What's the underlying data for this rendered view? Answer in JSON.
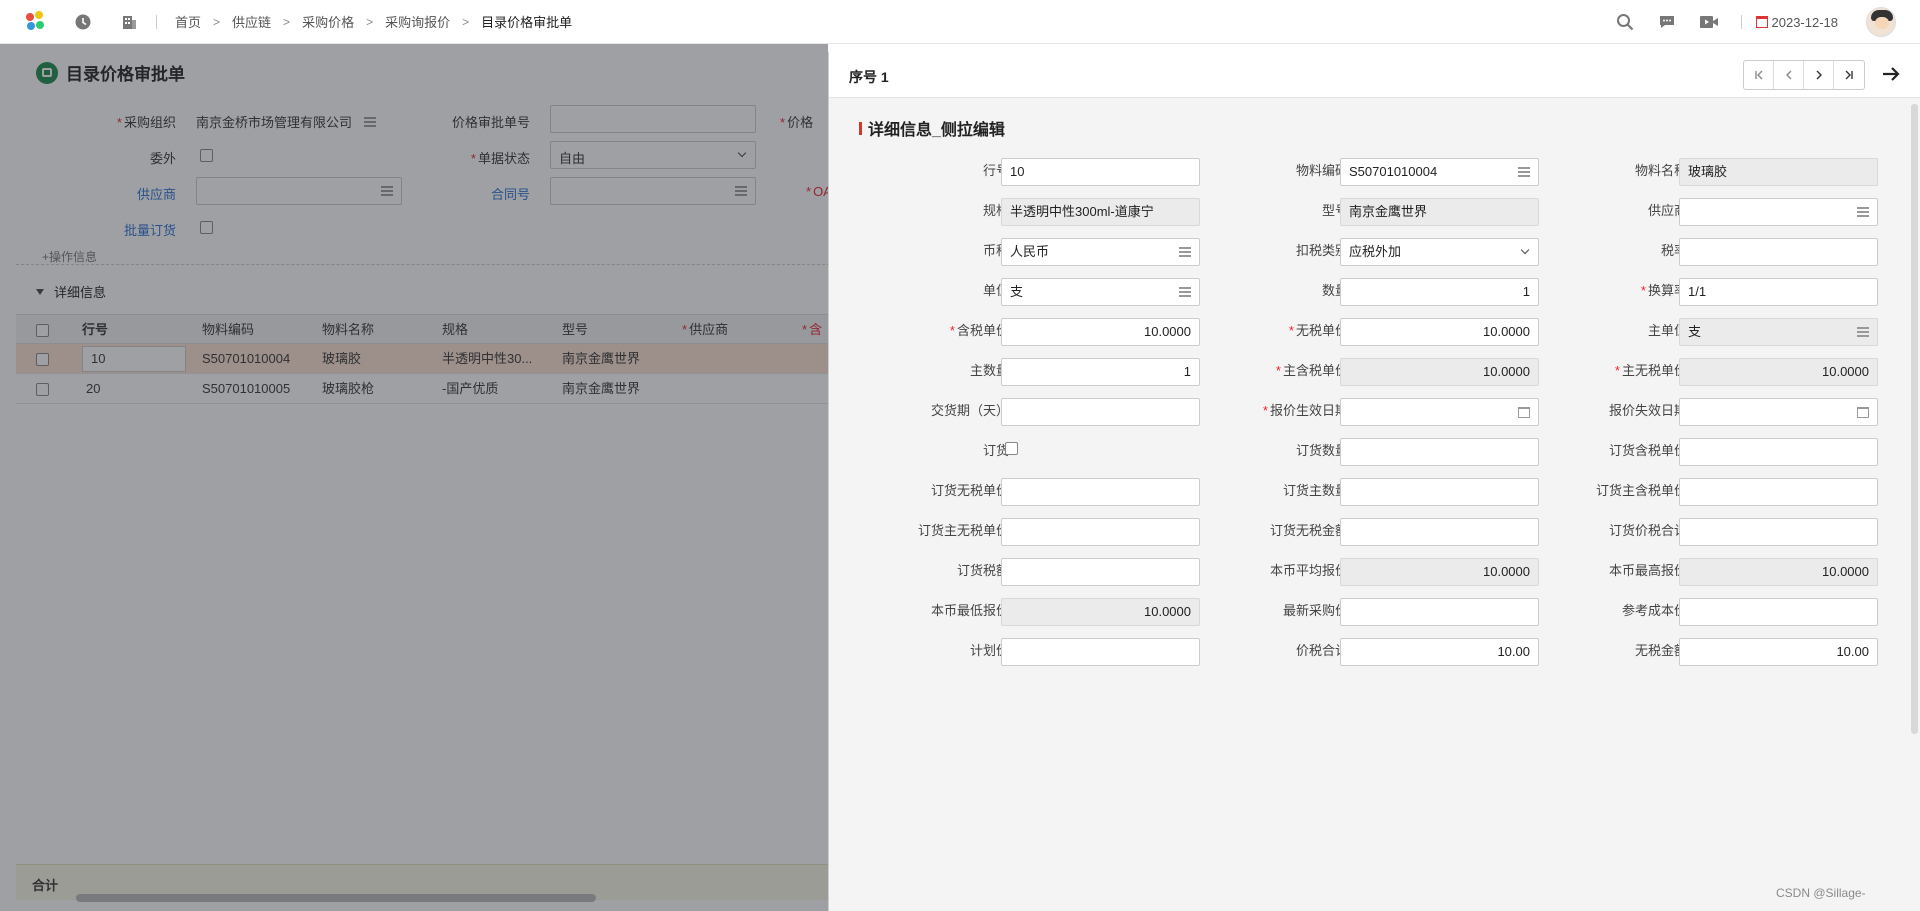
{
  "topbar": {
    "breadcrumb": [
      "首页",
      "供应链",
      "采购价格",
      "采购询报价",
      "目录价格审批单"
    ],
    "date": "2023-12-18"
  },
  "page": {
    "title": "目录价格审批单",
    "form": {
      "purchase_org_label": "采购组织",
      "purchase_org_value": "南京金桥市场管理有限公司",
      "approval_no_label": "价格审批单号",
      "price_label": "价格",
      "outsource_label": "委外",
      "doc_status_label": "单据状态",
      "doc_status_value": "自由",
      "supplier_label": "供应商",
      "contract_label": "合同号",
      "oa_label": "OA",
      "batch_order_label": "批量订货",
      "ops_info": "+操作信息"
    },
    "detail_section": "详细信息",
    "grid": {
      "headers": [
        "行号",
        "物料编码",
        "物料名称",
        "规格",
        "型号",
        "供应商",
        "含"
      ],
      "rows": [
        {
          "line": "10",
          "code": "S50701010004",
          "name": "玻璃胶",
          "spec": "半透明中性30...",
          "model": "南京金鹰世界"
        },
        {
          "line": "20",
          "code": "S50701010005",
          "name": "玻璃胶枪",
          "spec": "-国产优质",
          "model": "南京金鹰世界"
        }
      ]
    },
    "total_label": "合计"
  },
  "panel": {
    "seq_label": "序号 1",
    "section_title": "详细信息_侧拉编辑",
    "fields": [
      {
        "label": "行号",
        "value": "10",
        "required": false
      },
      {
        "label": "物料编码",
        "value": "S50701010004",
        "required": false
      },
      {
        "label": "物料名称",
        "value": "玻璃胶",
        "required": false
      },
      {
        "label": "规格",
        "value": "半透明中性300ml-道康宁",
        "required": false
      },
      {
        "label": "型号",
        "value": "南京金鹰世界",
        "required": false
      },
      {
        "label": "供应商",
        "value": "",
        "required": false
      },
      {
        "label": "币种",
        "value": "人民币",
        "required": false
      },
      {
        "label": "扣税类别",
        "value": "应税外加",
        "required": false
      },
      {
        "label": "税率",
        "value": "",
        "required": false
      },
      {
        "label": "单位",
        "value": "支",
        "required": false
      },
      {
        "label": "数量",
        "value": "1",
        "required": false
      },
      {
        "label": "换算率",
        "value": "1/1",
        "required": true
      },
      {
        "label": "含税单价",
        "value": "10.0000",
        "required": true
      },
      {
        "label": "无税单价",
        "value": "10.0000",
        "required": true
      },
      {
        "label": "主单位",
        "value": "支",
        "required": false
      },
      {
        "label": "主数量",
        "value": "1",
        "required": false
      },
      {
        "label": "主含税单价",
        "value": "10.0000",
        "required": true
      },
      {
        "label": "主无税单价",
        "value": "10.0000",
        "required": true
      },
      {
        "label": "交货期（天）",
        "value": "",
        "required": false
      },
      {
        "label": "报价生效日期",
        "value": "",
        "required": true
      },
      {
        "label": "报价失效日期",
        "value": "",
        "required": false
      },
      {
        "label": "订货",
        "value": "",
        "required": false
      },
      {
        "label": "订货数量",
        "value": "",
        "required": false
      },
      {
        "label": "订货含税单价",
        "value": "",
        "required": false
      },
      {
        "label": "订货无税单价",
        "value": "",
        "required": false
      },
      {
        "label": "订货主数量",
        "value": "",
        "required": false
      },
      {
        "label": "订货主含税单价",
        "value": "",
        "required": false
      },
      {
        "label": "订货主无税单价",
        "value": "",
        "required": false
      },
      {
        "label": "订货无税金额",
        "value": "",
        "required": false
      },
      {
        "label": "订货价税合计",
        "value": "",
        "required": false
      },
      {
        "label": "订货税额",
        "value": "",
        "required": false
      },
      {
        "label": "本币平均报价",
        "value": "10.0000",
        "required": false
      },
      {
        "label": "本币最高报价",
        "value": "10.0000",
        "required": false
      },
      {
        "label": "本币最低报价",
        "value": "10.0000",
        "required": false
      },
      {
        "label": "最新采购价",
        "value": "",
        "required": false
      },
      {
        "label": "参考成本价",
        "value": "",
        "required": false
      },
      {
        "label": "计划价",
        "value": "",
        "required": false
      },
      {
        "label": "价税合计",
        "value": "10.00",
        "required": false
      },
      {
        "label": "无税金额",
        "value": "10.00",
        "required": false
      }
    ]
  },
  "watermark": "CSDN @Sillage-",
  "colors": {
    "required": "#e23",
    "accent": "#1b8a4c",
    "selected_row": "#fde2d3"
  }
}
